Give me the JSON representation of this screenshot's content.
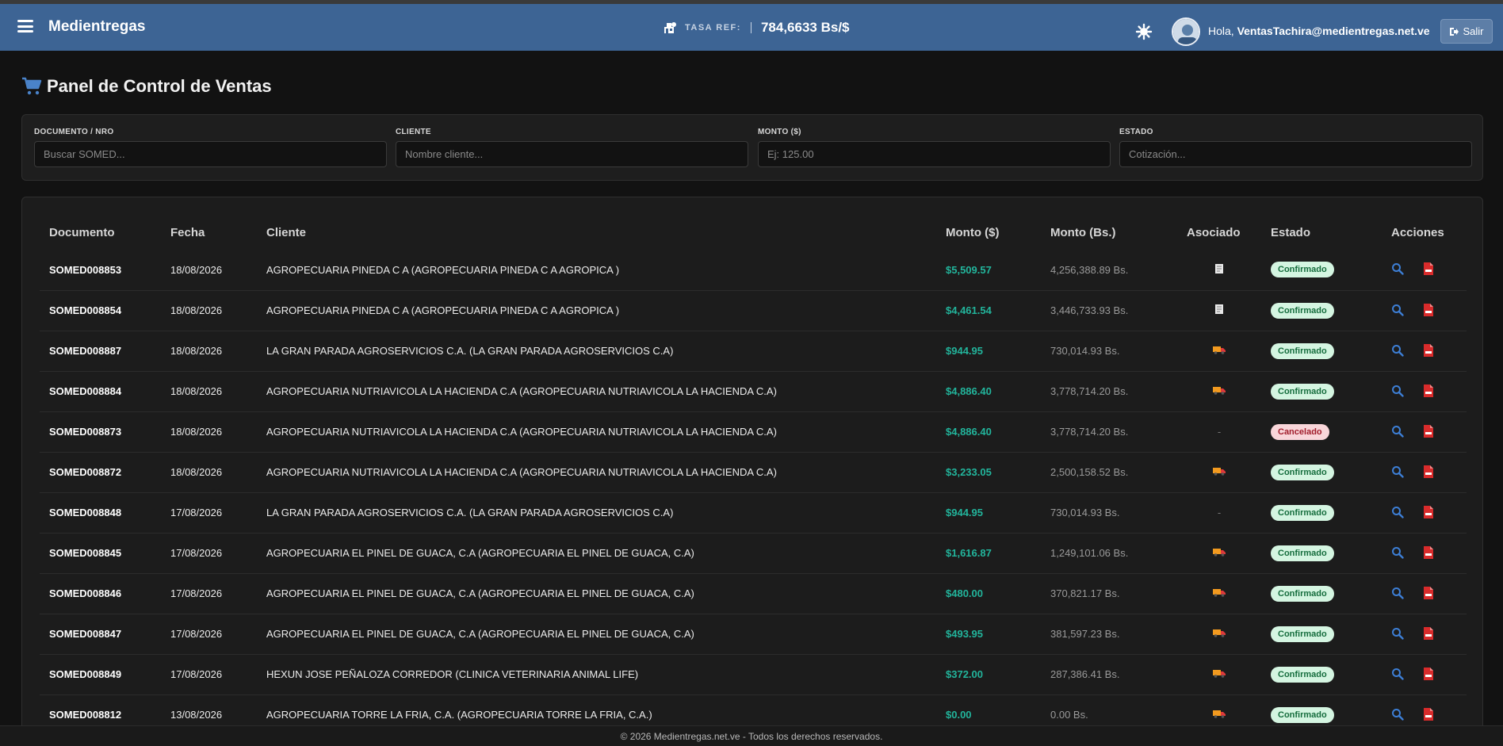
{
  "navbar": {
    "brand": "Medientregas",
    "rate_label": "TASA REF:",
    "rate_value": "784,6633 Bs/$",
    "greeting_prefix": "Hola,",
    "user_email": "VentasTachira@medientregas.net.ve",
    "logout_label": "Salir"
  },
  "page": {
    "title": "Panel de Control de Ventas"
  },
  "filters": {
    "documento": {
      "label": "DOCUMENTO / NRO",
      "placeholder": "Buscar SOMED..."
    },
    "cliente": {
      "label": "CLIENTE",
      "placeholder": "Nombre cliente..."
    },
    "monto": {
      "label": "MONTO ($)",
      "placeholder": "Ej: 125.00"
    },
    "estado": {
      "label": "ESTADO",
      "placeholder": "Cotización..."
    }
  },
  "table": {
    "headers": [
      "Documento",
      "Fecha",
      "Cliente",
      "Monto ($)",
      "Monto (Bs.)",
      "Asociado",
      "Estado",
      "Acciones"
    ],
    "rows": [
      {
        "doc": "SOMED008853",
        "fecha": "18/08/2026",
        "cliente": "AGROPECUARIA PINEDA C A (AGROPECUARIA PINEDA C A AGROPICA )",
        "usd": "$5,509.57",
        "bs": "4,256,388.89 Bs.",
        "asoc": "doc-icon",
        "estado": "Confirmado",
        "status": "ok"
      },
      {
        "doc": "SOMED008854",
        "fecha": "18/08/2026",
        "cliente": "AGROPECUARIA PINEDA C A (AGROPECUARIA PINEDA C A AGROPICA )",
        "usd": "$4,461.54",
        "bs": "3,446,733.93 Bs.",
        "asoc": "doc-icon",
        "estado": "Confirmado",
        "status": "ok"
      },
      {
        "doc": "SOMED008887",
        "fecha": "18/08/2026",
        "cliente": "LA GRAN PARADA AGROSERVICIOS C.A. (LA GRAN PARADA AGROSERVICIOS C.A)",
        "usd": "$944.95",
        "bs": "730,014.93 Bs.",
        "asoc": "truck-icon",
        "estado": "Confirmado",
        "status": "ok"
      },
      {
        "doc": "SOMED008884",
        "fecha": "18/08/2026",
        "cliente": "AGROPECUARIA NUTRIAVICOLA LA HACIENDA C.A (AGROPECUARIA NUTRIAVICOLA LA HACIENDA C.A)",
        "usd": "$4,886.40",
        "bs": "3,778,714.20 Bs.",
        "asoc": "truck-icon",
        "estado": "Confirmado",
        "status": "ok"
      },
      {
        "doc": "SOMED008873",
        "fecha": "18/08/2026",
        "cliente": "AGROPECUARIA NUTRIAVICOLA LA HACIENDA C.A (AGROPECUARIA NUTRIAVICOLA LA HACIENDA C.A)",
        "usd": "$4,886.40",
        "bs": "3,778,714.20 Bs.",
        "asoc": "-",
        "estado": "Cancelado",
        "status": "cancel"
      },
      {
        "doc": "SOMED008872",
        "fecha": "18/08/2026",
        "cliente": "AGROPECUARIA NUTRIAVICOLA LA HACIENDA C.A (AGROPECUARIA NUTRIAVICOLA LA HACIENDA C.A)",
        "usd": "$3,233.05",
        "bs": "2,500,158.52 Bs.",
        "asoc": "truck-icon",
        "estado": "Confirmado",
        "status": "ok"
      },
      {
        "doc": "SOMED008848",
        "fecha": "17/08/2026",
        "cliente": "LA GRAN PARADA AGROSERVICIOS C.A. (LA GRAN PARADA AGROSERVICIOS C.A)",
        "usd": "$944.95",
        "bs": "730,014.93 Bs.",
        "asoc": "-",
        "estado": "Confirmado",
        "status": "ok"
      },
      {
        "doc": "SOMED008845",
        "fecha": "17/08/2026",
        "cliente": "AGROPECUARIA EL PINEL DE GUACA, C.A (AGROPECUARIA EL PINEL DE GUACA, C.A)",
        "usd": "$1,616.87",
        "bs": "1,249,101.06 Bs.",
        "asoc": "truck-icon",
        "estado": "Confirmado",
        "status": "ok"
      },
      {
        "doc": "SOMED008846",
        "fecha": "17/08/2026",
        "cliente": "AGROPECUARIA EL PINEL DE GUACA, C.A (AGROPECUARIA EL PINEL DE GUACA, C.A)",
        "usd": "$480.00",
        "bs": "370,821.17 Bs.",
        "asoc": "truck-icon",
        "estado": "Confirmado",
        "status": "ok"
      },
      {
        "doc": "SOMED008847",
        "fecha": "17/08/2026",
        "cliente": "AGROPECUARIA EL PINEL DE GUACA, C.A (AGROPECUARIA EL PINEL DE GUACA, C.A)",
        "usd": "$493.95",
        "bs": "381,597.23 Bs.",
        "asoc": "truck-icon",
        "estado": "Confirmado",
        "status": "ok"
      },
      {
        "doc": "SOMED008849",
        "fecha": "17/08/2026",
        "cliente": "HEXUN JOSE PEÑALOZA CORREDOR (CLINICA VETERINARIA ANIMAL LIFE)",
        "usd": "$372.00",
        "bs": "287,386.41 Bs.",
        "asoc": "truck-icon",
        "estado": "Confirmado",
        "status": "ok"
      },
      {
        "doc": "SOMED008812",
        "fecha": "13/08/2026",
        "cliente": "AGROPECUARIA TORRE LA FRIA, C.A. (AGROPECUARIA TORRE LA FRIA, C.A.)",
        "usd": "$0.00",
        "bs": "0.00 Bs.",
        "asoc": "truck-icon",
        "estado": "Confirmado",
        "status": "ok"
      }
    ]
  },
  "footer": {
    "text": "© 2026 Medientregas.net.ve - Todos los derechos reservados."
  },
  "colors": {
    "navbar": "#3d6494",
    "usd": "#22b59c",
    "confirmado_bg": "#d4f5e1",
    "cancelado_bg": "#f9d6da",
    "search_icon": "#3d7fd6",
    "pdf_icon": "#d92b2b"
  }
}
